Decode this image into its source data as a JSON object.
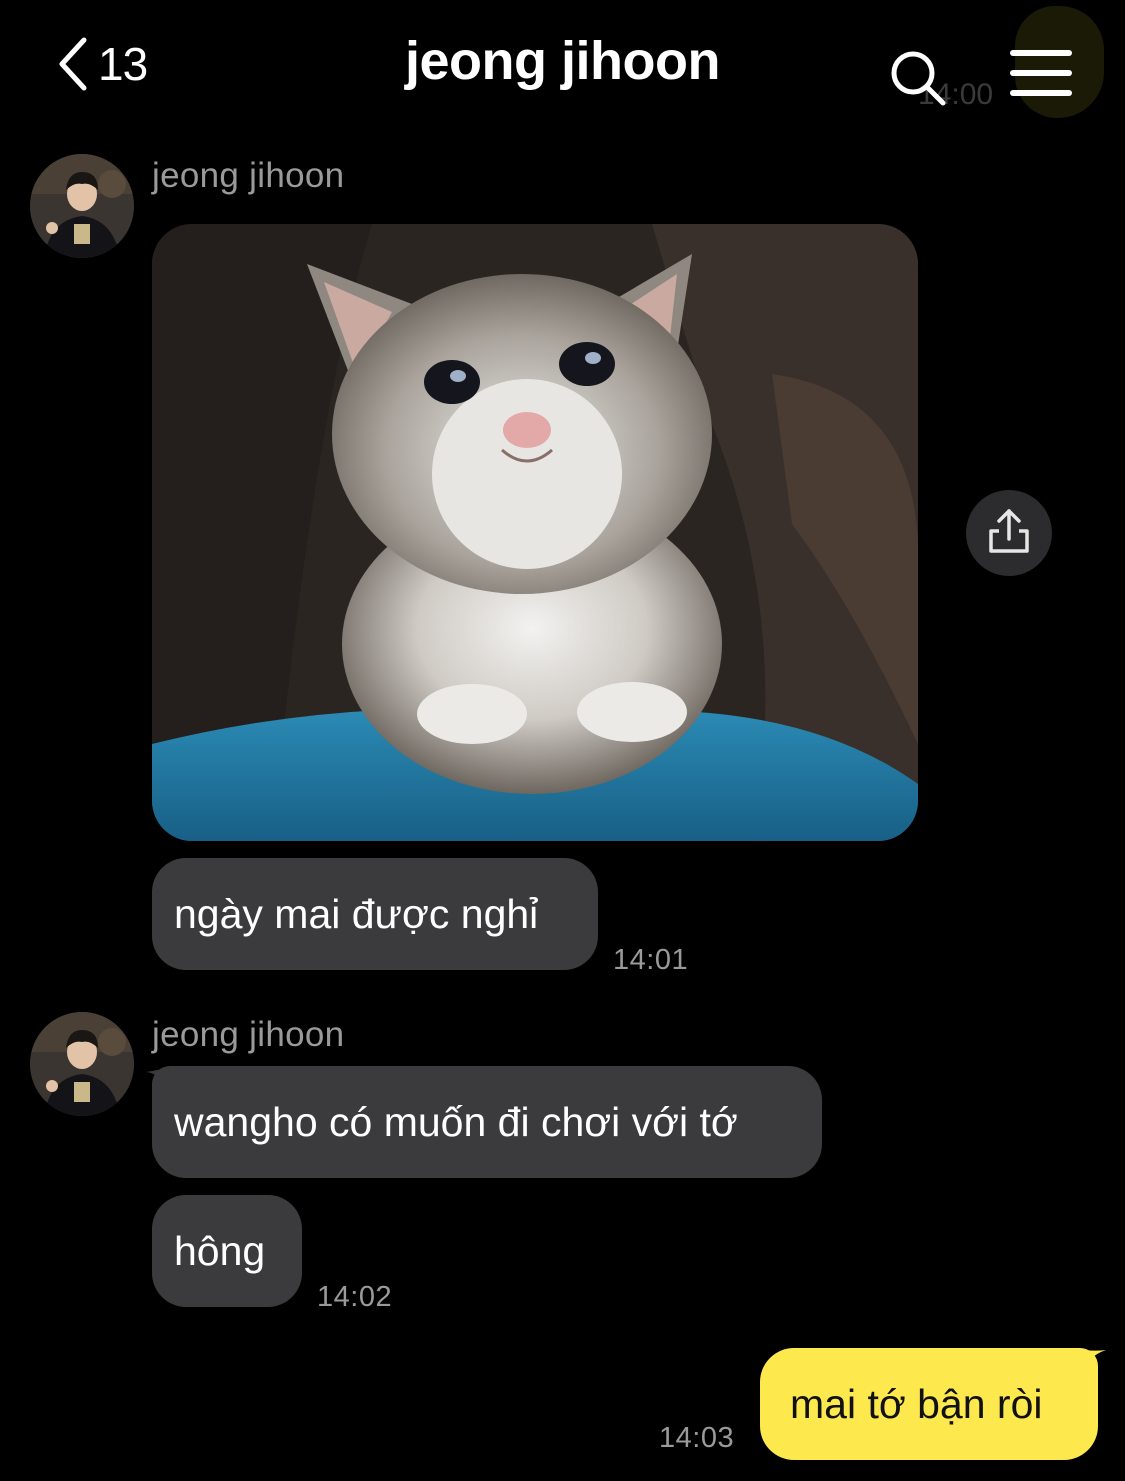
{
  "header": {
    "back_count": "13",
    "title": "jeong jihoon",
    "ghost_time": "14:00"
  },
  "icons": {
    "back": "chevron-left-icon",
    "search": "search-icon",
    "menu": "hamburger-menu-icon",
    "share": "share-icon"
  },
  "colors": {
    "background": "#000000",
    "incoming_bubble": "#3b3b3d",
    "outgoing_bubble": "#fde84d",
    "meta_text": "#9a9a9a"
  },
  "messages": {
    "group1": {
      "sender": "jeong jihoon",
      "image": "crying-kitten-photo",
      "text": "ngày mai được nghỉ",
      "time": "14:01"
    },
    "group2": {
      "sender": "jeong jihoon",
      "text1": "wangho có muốn đi chơi với tớ",
      "text2": "hông",
      "time": "14:02"
    },
    "outgoing": {
      "text": "mai tớ bận ròi",
      "time": "14:03"
    }
  }
}
